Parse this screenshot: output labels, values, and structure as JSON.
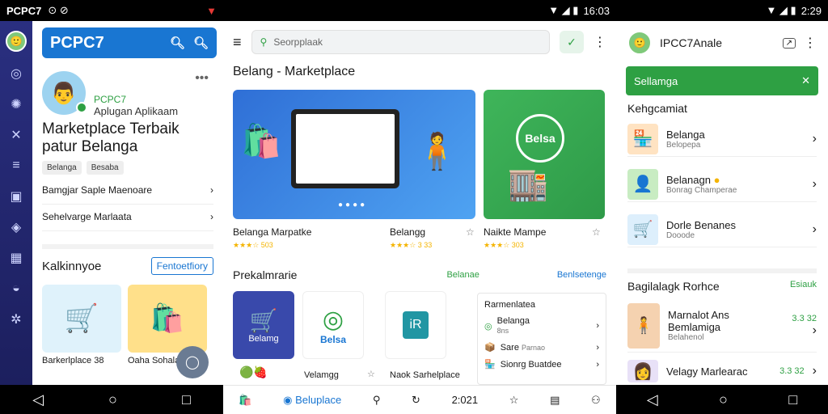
{
  "screen1": {
    "status_left": "PCPC7",
    "brand": "PCPC7",
    "profile_name": "PCPC7",
    "profile_sub": "Aplugan Aplikaam",
    "headline": "Marketplace Terbaik patur Belanga",
    "chips": [
      "Belanga",
      "Besaba"
    ],
    "rows": [
      "Bamgjar Saple Maenoare",
      "Sehelvarge Marlaata"
    ],
    "section_title": "Kalkinnyoe",
    "section_link": "Fentoetfiory",
    "cards": [
      {
        "label": "Barkerlplace",
        "price": "38",
        "icon": "🛒",
        "bg": "#dff2fb"
      },
      {
        "label": "Oaha Sohalae",
        "price": "",
        "icon": "🛍️",
        "bg": "#ffe08a"
      }
    ]
  },
  "screen2": {
    "time": "16:03",
    "search_placeholder": "Seorpplaak",
    "title": "Belang - Marketplace",
    "cap_a": "Belanga Marpatke",
    "cap_b": "Belangg",
    "cap_c": "Naikte Mampe",
    "stars_a": "★★★☆ 503",
    "stars_b": "★★★☆ 3 33",
    "stars_c": "★★★☆ 303",
    "banner_logo": "Belsa",
    "sec_title": "Prekalmrarie",
    "sec_g": "Belanae",
    "sec_b": "Benlsetenge",
    "tile_a": "Belamg",
    "tile_b": "Belsa",
    "tile_c": "iR",
    "caps2": [
      "Velamgg",
      "Naok Sarhelplace"
    ],
    "panel_title": "Rarmenlatea",
    "panel_items": [
      {
        "name": "Belanga",
        "sub": "8ns"
      },
      {
        "name": "Sare",
        "sub": "Parnao"
      },
      {
        "name": "Sionrg Buatdee",
        "sub": ""
      }
    ],
    "bnav_active": "Beluplace",
    "bnav_count": "2:021"
  },
  "screen3": {
    "time": "2:29",
    "title": "IPCC7Anale",
    "green_bar": "Sellamga",
    "kat": "Kehgcamiat",
    "items": [
      {
        "name": "Belanga",
        "sub": "Belopepa",
        "icon": "🏪",
        "bg": "#ffe3c2"
      },
      {
        "name": "Belanagn",
        "sub": "Bonrag Champerae",
        "icon": "👤",
        "bg": "#c8ecc2"
      },
      {
        "name": "Dorle Benanes",
        "sub": "Dooode",
        "icon": "🛒",
        "bg": "#ddeffc"
      }
    ],
    "sec_title": "Bagilalagk Rorhce",
    "sec_link": "Esiauk",
    "items2": [
      {
        "name": "Marnalot Ans Bemlamiga",
        "sub": "Belahenol",
        "price": "3.3 32",
        "icon": "🧍",
        "bg": "#f5d2b0"
      },
      {
        "name": "Velagy Marlearac",
        "sub": "",
        "price": "3.3 32",
        "icon": "👩",
        "bg": "#e8e1f7"
      }
    ]
  }
}
